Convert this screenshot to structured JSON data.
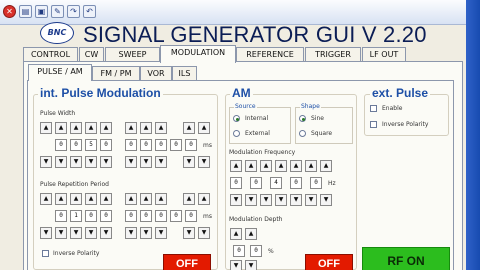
{
  "app": {
    "title": "SIGNAL GENERATOR GUI V 2.20",
    "logo_text": "BNC"
  },
  "quick_toolbar": {
    "icons": [
      "close-icon",
      "print-icon",
      "save-icon",
      "wrench-icon",
      "redo-icon",
      "undo-icon"
    ]
  },
  "main_tabs": [
    "CONTROL",
    "CW",
    "SWEEP",
    "MODULATION",
    "REFERENCE",
    "TRIGGER",
    "LF OUT"
  ],
  "active_main_tab": "MODULATION",
  "sub_tabs": [
    "PULSE / AM",
    "FM / PM",
    "VOR",
    "ILS"
  ],
  "active_sub_tab": "PULSE / AM",
  "pulse": {
    "heading": "int. Pulse Modulation",
    "width_label": "Pulse Width",
    "width_digits": [
      "0",
      "0",
      "5",
      "0"
    ],
    "width_digits_b": [
      "0",
      "0",
      "0"
    ],
    "width_digits_c": [
      "0",
      "0",
      "0"
    ],
    "width_unit": "ms",
    "period_label": "Pulse Repetition Period",
    "period_digits": [
      "0",
      "1",
      "0",
      "0"
    ],
    "period_digits_b": [
      "0",
      "0",
      "0"
    ],
    "period_digits_c": [
      "0",
      "0",
      "0"
    ],
    "period_unit": "ms",
    "inverse_label": "Inverse Polarity",
    "off_label": "OFF"
  },
  "am": {
    "heading": "AM",
    "source_legend": "Source",
    "source_options": [
      "Internal",
      "External"
    ],
    "source_selected": "Internal",
    "shape_legend": "Shape",
    "shape_options": [
      "Sine",
      "Square"
    ],
    "shape_selected": "Sine",
    "freq_label": "Modulation Frequency",
    "freq_digits": [
      "0",
      "0",
      "4",
      "0",
      "0"
    ],
    "freq_unit": "Hz",
    "depth_label": "Modulation Depth",
    "depth_digits": [
      "0",
      "0"
    ],
    "depth_unit": "%",
    "off_label": "OFF"
  },
  "ext_pulse": {
    "heading": "ext. Pulse",
    "enable_label": "Enable",
    "inverse_label": "Inverse Polarity",
    "rf_label": "RF ON"
  }
}
